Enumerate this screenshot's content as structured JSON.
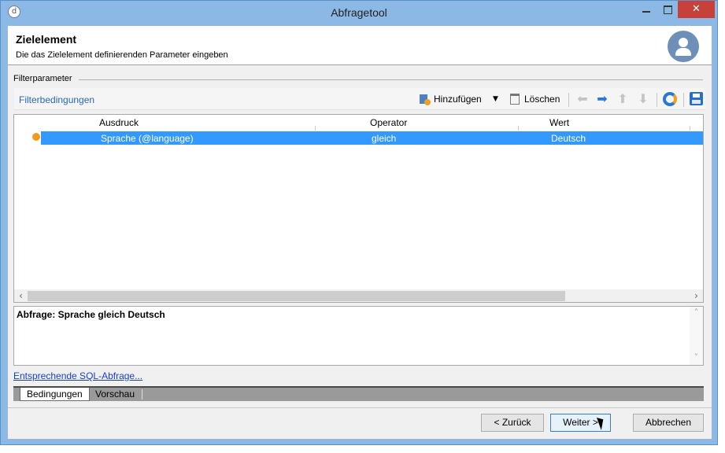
{
  "window": {
    "title": "Abfragetool",
    "close_glyph": "✕"
  },
  "header": {
    "title": "Zielelement",
    "subtitle": "Die das Zielelement definierenden Parameter eingeben"
  },
  "filter": {
    "group_label": "Filterparameter",
    "section_label": "Filterbedingungen",
    "toolbar": {
      "add_label": "Hinzufügen",
      "delete_label": "Löschen"
    }
  },
  "grid": {
    "columns": [
      "Ausdruck",
      "Operator",
      "Wert"
    ],
    "rows": [
      {
        "expression": "Sprache (@language)",
        "operator": "gleich",
        "value": "Deutsch"
      }
    ]
  },
  "query": {
    "text": "Abfrage: Sprache gleich Deutsch"
  },
  "sql_link": "Entsprechende SQL-Abfrage...",
  "tabs": [
    "Bedingungen",
    "Vorschau"
  ],
  "buttons": {
    "back": "< Zurück",
    "next": "Weiter >",
    "cancel": "Abbrechen"
  },
  "colors": {
    "titlebar": "#8cb8e6",
    "selection": "#3399ff",
    "close_button": "#c7403a",
    "row_marker": "#f39a1e"
  },
  "icons": {
    "add": "add-condition-icon",
    "delete": "trash-icon",
    "chart": "chart-icon",
    "save": "save-icon"
  }
}
